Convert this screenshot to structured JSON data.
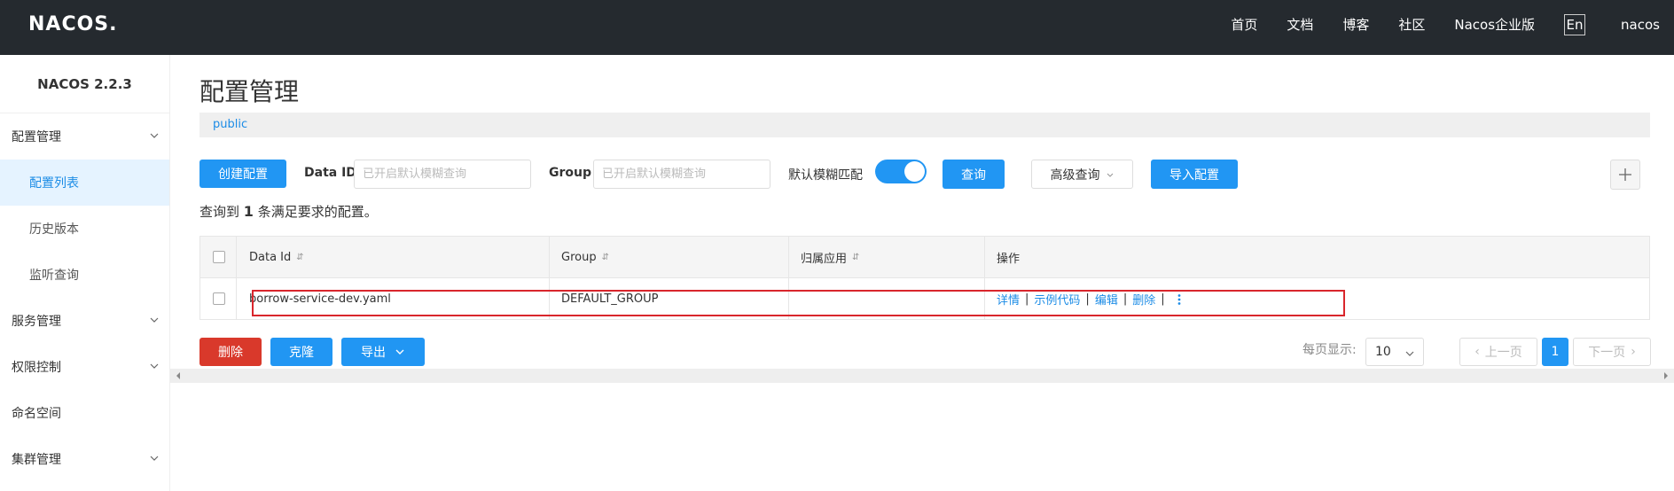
{
  "header": {
    "logo_text": "NACOS.",
    "nav": [
      "首页",
      "文档",
      "博客",
      "社区",
      "Nacos企业版"
    ],
    "lang_label": "En",
    "user": "nacos"
  },
  "sidebar": {
    "version": "NACOS 2.2.3",
    "items": [
      {
        "label": "配置管理",
        "expandable": true
      },
      {
        "label": "配置列表",
        "sub": true,
        "active": true
      },
      {
        "label": "历史版本",
        "sub": true
      },
      {
        "label": "监听查询",
        "sub": true
      },
      {
        "label": "服务管理",
        "expandable": true
      },
      {
        "label": "权限控制",
        "expandable": true
      },
      {
        "label": "命名空间"
      },
      {
        "label": "集群管理",
        "expandable": true
      }
    ]
  },
  "main": {
    "title": "配置管理",
    "namespace": "public",
    "create_button": "创建配置",
    "data_id_label": "Data ID",
    "data_id_placeholder": "已开启默认模糊查询",
    "group_label": "Group",
    "group_placeholder": "已开启默认模糊查询",
    "fuzzy_label": "默认模糊匹配",
    "fuzzy_enabled": true,
    "query_button": "查询",
    "advanced_button": "高级查询",
    "import_button": "导入配置",
    "add_icon": "plus-icon",
    "result_prefix": "查询到",
    "result_count": "1",
    "result_suffix": "条满足要求的配置。"
  },
  "table": {
    "columns": [
      "Data Id",
      "Group",
      "归属应用",
      "操作"
    ],
    "rows": [
      {
        "data_id": "borrow-service-dev.yaml",
        "group": "DEFAULT_GROUP",
        "app": "",
        "ops": [
          "详情",
          "示例代码",
          "编辑",
          "删除"
        ]
      }
    ]
  },
  "footer": {
    "delete_button": "删除",
    "clone_button": "克隆",
    "export_button": "导出",
    "page_size_label": "每页显示:",
    "page_size": "10",
    "prev": "上一页",
    "current_page": "1",
    "next": "下一页"
  },
  "colors": {
    "primary": "#2196f3",
    "danger": "#d9392b",
    "topbar": "#252a2f",
    "highlight": "#d9262c"
  }
}
